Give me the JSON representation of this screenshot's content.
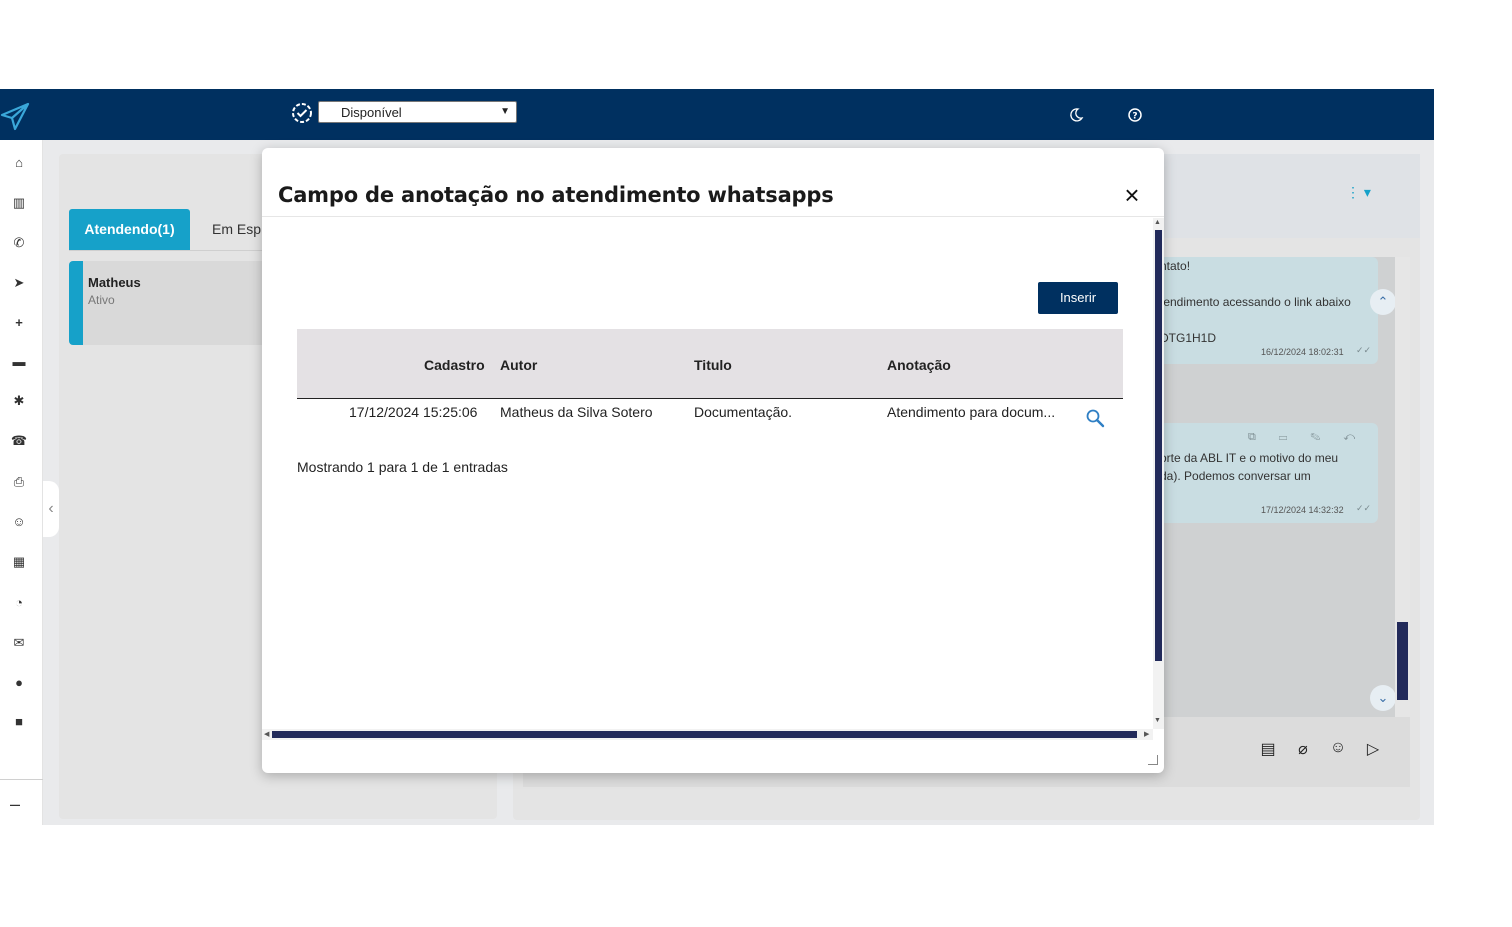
{
  "topbar": {
    "status_value": "Disponível",
    "status_options": [
      "Disponível"
    ]
  },
  "sidebar": {
    "icons": [
      "home-icon",
      "chart-icon",
      "whatsapp-icon",
      "send-icon",
      "plus-icon",
      "briefcase-icon",
      "gear-icon",
      "phone-icon",
      "print-icon",
      "smile-icon",
      "calendar-icon",
      "dashboard-icon",
      "chat-icon",
      "comment-icon",
      "video-icon"
    ],
    "minus_label": "–"
  },
  "left_panel": {
    "tabs": [
      {
        "label": "Atendendo(1)",
        "active": true
      },
      {
        "label": "Em Esp",
        "active": false
      }
    ],
    "contact": {
      "name": "Matheus",
      "status": "Ativo"
    }
  },
  "chat": {
    "messages": [
      {
        "lines": [
          "ntato!",
          "",
          "tendimento acessando o link abaixo",
          "",
          "DTG1H1D"
        ],
        "time": "16/12/2024 18:02:31"
      },
      {
        "lines": [
          "orte da ABL IT e o motivo do meu",
          "da). Podemos conversar um"
        ],
        "time": "17/12/2024 14:32:32"
      }
    ]
  },
  "modal": {
    "title": "Campo de anotação no atendimento whatsapps",
    "close_label": "×",
    "insert_label": "Inserir",
    "table": {
      "columns": [
        "Cadastro",
        "Autor",
        "Titulo",
        "Anotação"
      ],
      "rows": [
        {
          "cadastro": "17/12/2024 15:25:06",
          "autor": "Matheus da Silva Sotero",
          "titulo": "Documentação.",
          "anotacao": "Atendimento para docum..."
        }
      ]
    },
    "entries_info": "Mostrando 1 para 1 de 1 entradas"
  },
  "colors": {
    "topbar": "#003060",
    "accent": "#16a1c9",
    "button": "#003060",
    "scrollbar": "#222a5a"
  }
}
